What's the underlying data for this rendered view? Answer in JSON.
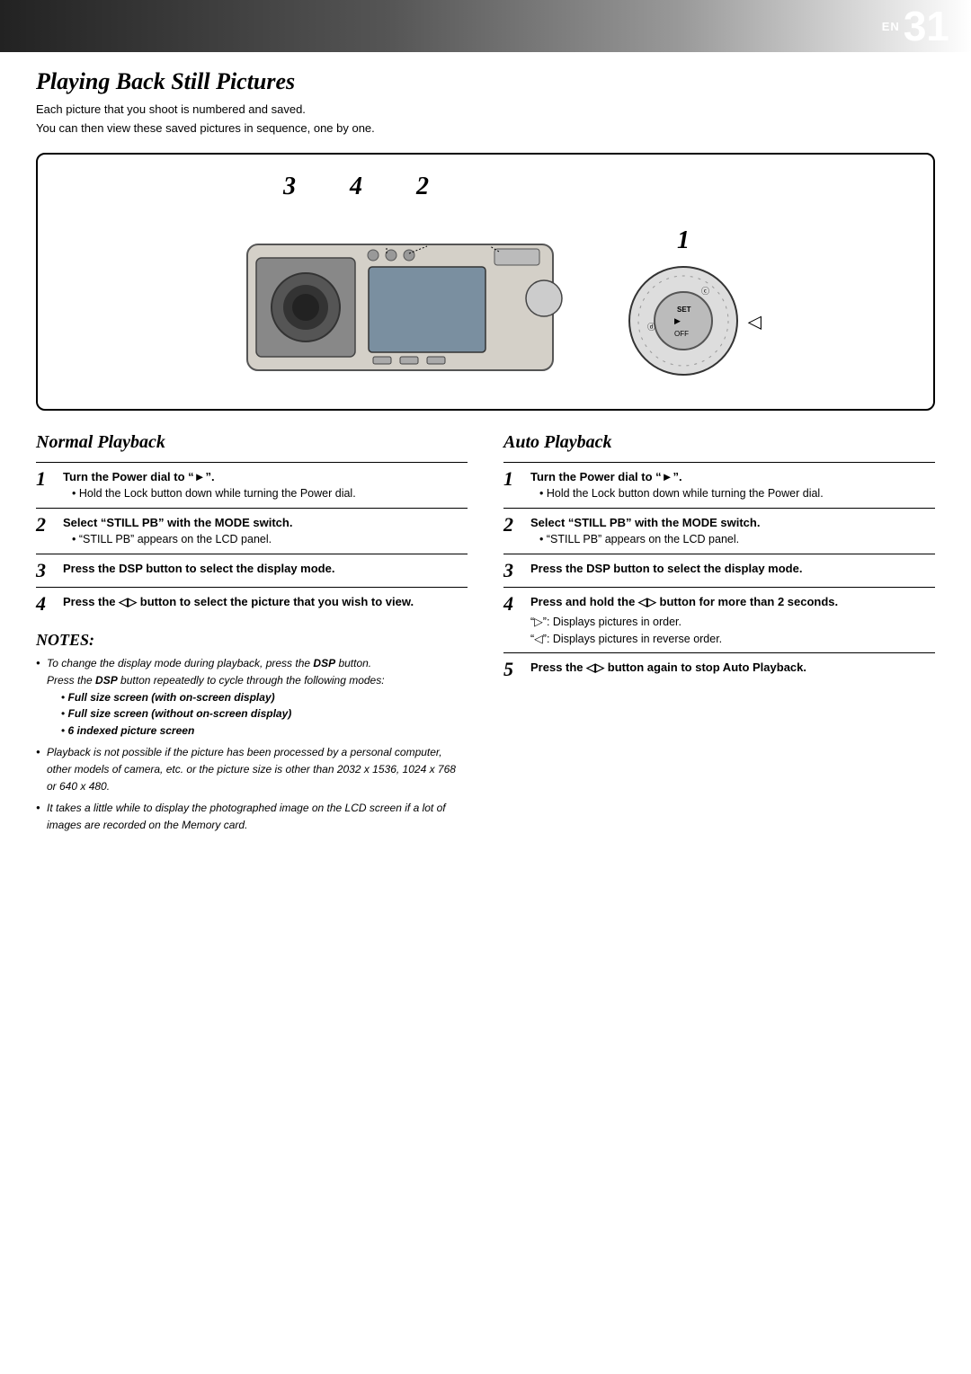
{
  "header": {
    "en_label": "EN",
    "page_number": "31"
  },
  "page": {
    "title": "Playing Back Still Pictures",
    "subtitle_line1": "Each picture that you shoot is numbered and saved.",
    "subtitle_line2": "You can then view these saved pictures in sequence, one by one."
  },
  "diagram": {
    "step_numbers": [
      "3",
      "4",
      "2",
      "1"
    ],
    "dial_labels": [
      "SET",
      "▶",
      "OFF"
    ]
  },
  "normal_playback": {
    "title": "Normal Playback",
    "steps": [
      {
        "number": "1",
        "main": "Turn the Power dial to “►”.",
        "sub": "Hold the Lock button down while turning the Power dial."
      },
      {
        "number": "2",
        "main": "Select “STILL PB” with the MODE switch.",
        "sub": "“STILL PB” appears on the LCD panel."
      },
      {
        "number": "3",
        "main": "Press the DSP button to select the display mode."
      },
      {
        "number": "4",
        "main": "Press the ◁▷ button to select the picture that you wish to view."
      }
    ],
    "notes_title": "NOTES:",
    "notes": [
      {
        "text": "To change the display mode during playback, press the DSP button.\nPress the DSP button repeatedly to cycle through the following modes:",
        "sub_items": [
          "Full size screen (with on-screen display)",
          "Full size screen (without on-screen display)",
          "6 indexed picture screen"
        ]
      },
      {
        "text": "Playback is not possible if the picture has been processed by a personal computer, other models of camera, etc. or the picture size is other than 2032 x 1536, 1024 x 768 or 640 x 480."
      },
      {
        "text": "It takes a little while to display the photographed image on the LCD screen if a lot of images are recorded on the Memory card."
      }
    ]
  },
  "auto_playback": {
    "title": "Auto Playback",
    "steps": [
      {
        "number": "1",
        "main": "Turn the Power dial to “►”.",
        "sub": "Hold the Lock button down while turning the Power dial."
      },
      {
        "number": "2",
        "main": "Select “STILL PB” with the MODE switch.",
        "sub": "“STILL PB” appears on the LCD panel."
      },
      {
        "number": "3",
        "main": "Press the DSP button to select the display mode."
      },
      {
        "number": "4",
        "main": "Press and hold the ◁▷ button for more than 2 seconds.",
        "sub_items": [
          "“▷”: Displays pictures in order.",
          "“◁”: Displays pictures in reverse order."
        ]
      },
      {
        "number": "5",
        "main": "Press the ◁▷ button again to stop Auto Playback."
      }
    ]
  }
}
